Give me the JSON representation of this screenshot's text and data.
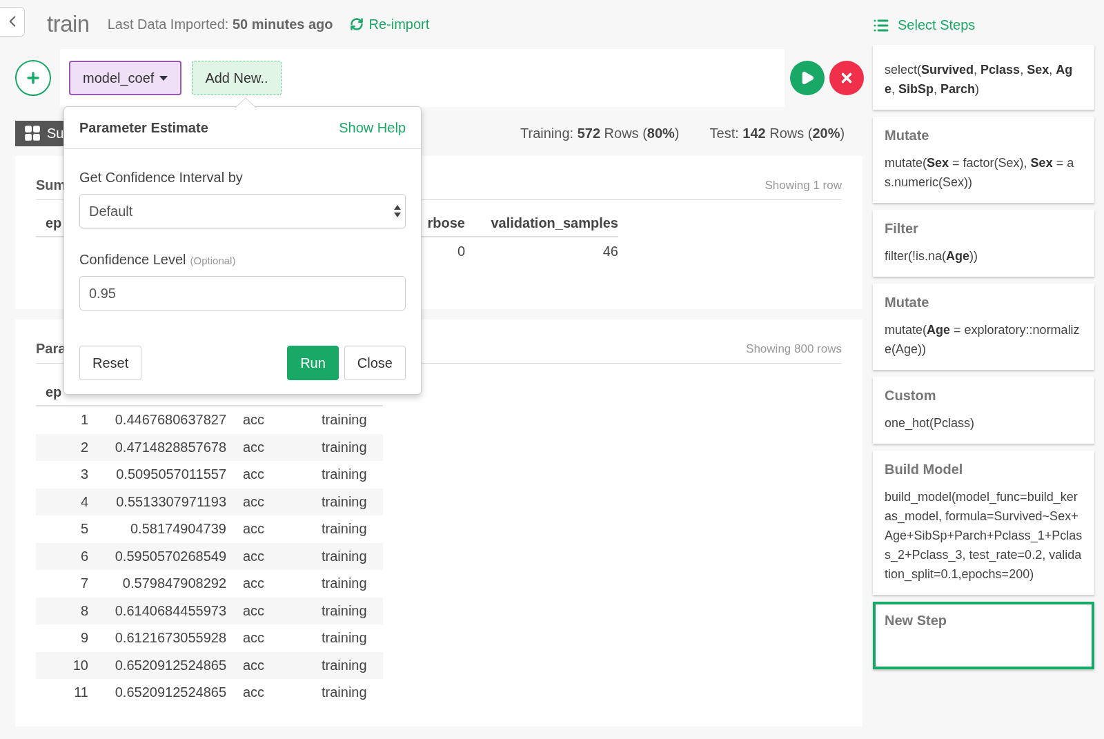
{
  "header": {
    "title": "train",
    "import_label": "Last Data Imported:",
    "import_time": "50 minutes ago",
    "reimport": "Re-import"
  },
  "toolbar": {
    "tabs": [
      {
        "label": "model_coef",
        "kind": "dropdown"
      },
      {
        "label": "Add New..",
        "kind": "add"
      }
    ]
  },
  "view_tab": {
    "label": "Su"
  },
  "split": {
    "training": "Training: **572** Rows (**80%**)",
    "test": "Test: **142** Rows (**20%**)"
  },
  "summary": {
    "title": "Sum",
    "status": "Showing 1 row",
    "columns": [
      {
        "label": "ep"
      },
      {
        "label": "rbose",
        "value": "0"
      },
      {
        "label": "validation_samples",
        "value": "46"
      }
    ]
  },
  "params": {
    "title": "Para",
    "status": "Showing 800 rows",
    "columns": [
      "ep"
    ],
    "rows": [
      [
        "1",
        "0.4467680637827",
        "acc",
        "training"
      ],
      [
        "2",
        "0.4714828857678",
        "acc",
        "training"
      ],
      [
        "3",
        "0.5095057011557",
        "acc",
        "training"
      ],
      [
        "4",
        "0.5513307971193",
        "acc",
        "training"
      ],
      [
        "5",
        "0.58174904739",
        "acc",
        "training"
      ],
      [
        "6",
        "0.5950570268549",
        "acc",
        "training"
      ],
      [
        "7",
        "0.579847908292",
        "acc",
        "training"
      ],
      [
        "8",
        "0.6140684455973",
        "acc",
        "training"
      ],
      [
        "9",
        "0.6121673055928",
        "acc",
        "training"
      ],
      [
        "10",
        "0.6520912524865",
        "acc",
        "training"
      ],
      [
        "11",
        "0.6520912524865",
        "acc",
        "training"
      ]
    ]
  },
  "popover": {
    "title": "Parameter Estimate",
    "help": "Show Help",
    "fields": [
      {
        "kind": "select",
        "label": "Get Confidence Interval by",
        "value": "Default"
      },
      {
        "kind": "input",
        "label": "Confidence Level",
        "note": "(Optional)",
        "value": "0.95"
      }
    ],
    "buttons": [
      {
        "label": "Reset",
        "kind": "default"
      },
      {
        "label": "Run",
        "kind": "primary"
      },
      {
        "label": "Close",
        "kind": "default"
      }
    ]
  },
  "steps_panel": {
    "title": "Select Steps",
    "steps": [
      {
        "code": "select(**Survived**, **Pclass**, **Sex**, **Age**, **SibSp**, **Parch**)",
        "selected": false
      },
      {
        "title": "Mutate",
        "code": "mutate(**Sex** = factor(Sex), **Sex** = as.numeric(Sex))",
        "selected": false
      },
      {
        "title": "Filter",
        "code": "filter(!is.na(**Age**))",
        "selected": false
      },
      {
        "title": "Mutate",
        "code": "mutate(**Age** = exploratory::normalize(Age))",
        "selected": false
      },
      {
        "title": "Custom",
        "code": "one_hot(Pclass)",
        "selected": false
      },
      {
        "title": "Build Model",
        "code": "build_model(model_func=build_keras_model, formula=Survived~Sex+Age+SibSp+Parch+Pclass_1+Pclass_2+Pclass_3, test_rate=0.2, validation_split=0.1,epochs=200)",
        "selected": false
      },
      {
        "title": "New Step",
        "selected": true
      }
    ]
  }
}
